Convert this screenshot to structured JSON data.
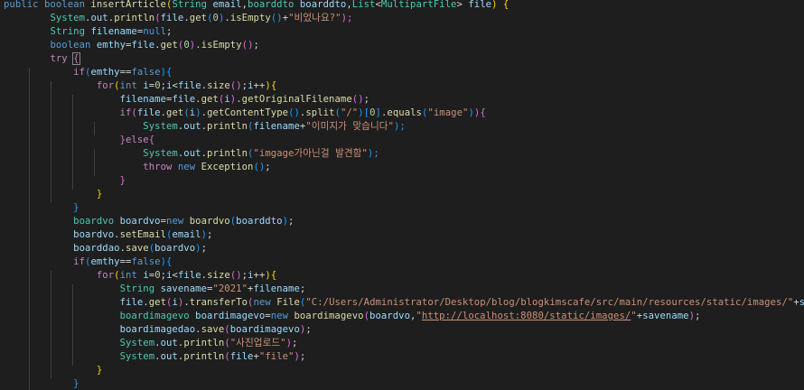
{
  "lines": [
    [
      [
        "public boolean ",
        "kw"
      ],
      [
        "insertArticle",
        "fn"
      ],
      [
        "(",
        "p0"
      ],
      [
        "String ",
        "ty"
      ],
      [
        "email",
        "var"
      ],
      [
        ",",
        "pl"
      ],
      [
        "boarddto ",
        "ty"
      ],
      [
        "boarddto",
        "var"
      ],
      [
        ",",
        "pl"
      ],
      [
        "List",
        "ty"
      ],
      [
        "<",
        "pl"
      ],
      [
        "MultipartFile",
        "ty"
      ],
      [
        "> ",
        "pl"
      ],
      [
        "file",
        "var"
      ],
      [
        ") {",
        "p0"
      ]
    ],
    [
      [
        "        ",
        "pl"
      ],
      [
        "System",
        "ty"
      ],
      [
        ".",
        "pl"
      ],
      [
        "out",
        "var"
      ],
      [
        ".",
        "pl"
      ],
      [
        "println",
        "fn"
      ],
      [
        "(",
        "p1"
      ],
      [
        "file",
        "var"
      ],
      [
        ".",
        "pl"
      ],
      [
        "get",
        "fn"
      ],
      [
        "(",
        "p2"
      ],
      [
        "0",
        "num"
      ],
      [
        ")",
        "p2"
      ],
      [
        ".",
        "pl"
      ],
      [
        "isEmpty",
        "fn"
      ],
      [
        "()",
        "p2"
      ],
      [
        "+",
        "pl"
      ],
      [
        "\"비었나요?\"",
        "str"
      ],
      [
        ");",
        "p1"
      ]
    ],
    [
      [
        "        ",
        "pl"
      ],
      [
        "String ",
        "ty"
      ],
      [
        "filename",
        "var"
      ],
      [
        "=",
        "pl"
      ],
      [
        "null",
        "kw"
      ],
      [
        ";",
        "pl"
      ]
    ],
    [
      [
        "        ",
        "pl"
      ],
      [
        "boolean ",
        "kw"
      ],
      [
        "emthy",
        "var"
      ],
      [
        "=",
        "pl"
      ],
      [
        "file",
        "var"
      ],
      [
        ".",
        "pl"
      ],
      [
        "get",
        "fn"
      ],
      [
        "(",
        "p1"
      ],
      [
        "0",
        "num"
      ],
      [
        ")",
        "p1"
      ],
      [
        ".",
        "pl"
      ],
      [
        "isEmpty",
        "fn"
      ],
      [
        "()",
        "p1"
      ],
      [
        ";",
        "pl"
      ]
    ],
    [
      [
        "        ",
        "pl"
      ],
      [
        "try ",
        "ctl"
      ],
      [
        "{",
        "p1"
      ]
    ],
    [
      [
        "            ",
        "pl"
      ],
      [
        "if",
        "ctl"
      ],
      [
        "(",
        "p2"
      ],
      [
        "emthy",
        "var"
      ],
      [
        "==",
        "pl"
      ],
      [
        "false",
        "kw"
      ],
      [
        ")",
        "p2"
      ],
      [
        "{",
        "p2"
      ]
    ],
    [
      [
        "                ",
        "pl"
      ],
      [
        "for",
        "ctl"
      ],
      [
        "(",
        "p0"
      ],
      [
        "int ",
        "kw"
      ],
      [
        "i",
        "var"
      ],
      [
        "=",
        "pl"
      ],
      [
        "0",
        "num"
      ],
      [
        ";",
        "pl"
      ],
      [
        "i",
        "var"
      ],
      [
        "<",
        "pl"
      ],
      [
        "file",
        "var"
      ],
      [
        ".",
        "pl"
      ],
      [
        "size",
        "fn"
      ],
      [
        "()",
        "p1"
      ],
      [
        ";",
        "pl"
      ],
      [
        "i",
        "var"
      ],
      [
        "++",
        "pl"
      ],
      [
        ")",
        "p0"
      ],
      [
        "{",
        "p0"
      ]
    ],
    [
      [
        "                    ",
        "pl"
      ],
      [
        "filename",
        "var"
      ],
      [
        "=",
        "pl"
      ],
      [
        "file",
        "var"
      ],
      [
        ".",
        "pl"
      ],
      [
        "get",
        "fn"
      ],
      [
        "(",
        "p1"
      ],
      [
        "i",
        "var"
      ],
      [
        ")",
        "p1"
      ],
      [
        ".",
        "pl"
      ],
      [
        "getOriginalFilename",
        "fn"
      ],
      [
        "()",
        "p1"
      ],
      [
        ";",
        "pl"
      ]
    ],
    [
      [
        "                    ",
        "pl"
      ],
      [
        "if",
        "ctl"
      ],
      [
        "(",
        "p1"
      ],
      [
        "file",
        "var"
      ],
      [
        ".",
        "pl"
      ],
      [
        "get",
        "fn"
      ],
      [
        "(",
        "p2"
      ],
      [
        "i",
        "var"
      ],
      [
        ")",
        "p2"
      ],
      [
        ".",
        "pl"
      ],
      [
        "getContentType",
        "fn"
      ],
      [
        "()",
        "p2"
      ],
      [
        ".",
        "pl"
      ],
      [
        "split",
        "fn"
      ],
      [
        "(",
        "p2"
      ],
      [
        "\"/\"",
        "str"
      ],
      [
        ")",
        "p2"
      ],
      [
        "[",
        "p2"
      ],
      [
        "0",
        "num"
      ],
      [
        "]",
        "p2"
      ],
      [
        ".",
        "pl"
      ],
      [
        "equals",
        "fn"
      ],
      [
        "(",
        "p2"
      ],
      [
        "\"image\"",
        "str"
      ],
      [
        ")",
        "p2"
      ],
      [
        ")",
        "p1"
      ],
      [
        "{",
        "p1"
      ]
    ],
    [
      [
        "                        ",
        "pl"
      ],
      [
        "System",
        "ty"
      ],
      [
        ".",
        "pl"
      ],
      [
        "out",
        "var"
      ],
      [
        ".",
        "pl"
      ],
      [
        "println",
        "fn"
      ],
      [
        "(",
        "p2"
      ],
      [
        "filename",
        "var"
      ],
      [
        "+",
        "pl"
      ],
      [
        "\"이미지가 맞습니다\"",
        "str"
      ],
      [
        ");",
        "p2"
      ]
    ],
    [
      [
        "                    ",
        "pl"
      ],
      [
        "}",
        "p1"
      ],
      [
        "else",
        "ctl"
      ],
      [
        "{",
        "p1"
      ]
    ],
    [
      [
        "                        ",
        "pl"
      ],
      [
        "System",
        "ty"
      ],
      [
        ".",
        "pl"
      ],
      [
        "out",
        "var"
      ],
      [
        ".",
        "pl"
      ],
      [
        "println",
        "fn"
      ],
      [
        "(",
        "p2"
      ],
      [
        "\"imgage가아닌걸 발견함\"",
        "str"
      ],
      [
        ");",
        "p2"
      ]
    ],
    [
      [
        "                        ",
        "pl"
      ],
      [
        "throw ",
        "ctl"
      ],
      [
        "new ",
        "kw"
      ],
      [
        "Exception",
        "fn"
      ],
      [
        "()",
        "p2"
      ],
      [
        ";",
        "pl"
      ]
    ],
    [
      [
        "                    ",
        "pl"
      ],
      [
        "}",
        "p1"
      ]
    ],
    [
      [
        "                ",
        "pl"
      ],
      [
        "}",
        "p0"
      ]
    ],
    [
      [
        "            ",
        "pl"
      ],
      [
        "}",
        "p2"
      ]
    ],
    [
      [
        "            ",
        "pl"
      ],
      [
        "boardvo ",
        "ty"
      ],
      [
        "boardvo",
        "var"
      ],
      [
        "=",
        "pl"
      ],
      [
        "new ",
        "kw"
      ],
      [
        "boardvo",
        "fn"
      ],
      [
        "(",
        "p2"
      ],
      [
        "boarddto",
        "var"
      ],
      [
        ")",
        "p2"
      ],
      [
        ";",
        "pl"
      ]
    ],
    [
      [
        "            ",
        "pl"
      ],
      [
        "boardvo",
        "var"
      ],
      [
        ".",
        "pl"
      ],
      [
        "setEmail",
        "fn"
      ],
      [
        "(",
        "p2"
      ],
      [
        "email",
        "var"
      ],
      [
        ")",
        "p2"
      ],
      [
        ";",
        "pl"
      ]
    ],
    [
      [
        "            ",
        "pl"
      ],
      [
        "boarddao",
        "var"
      ],
      [
        ".",
        "pl"
      ],
      [
        "save",
        "fn"
      ],
      [
        "(",
        "p2"
      ],
      [
        "boardvo",
        "var"
      ],
      [
        ")",
        "p2"
      ],
      [
        ";",
        "pl"
      ]
    ],
    [
      [
        "            ",
        "pl"
      ],
      [
        "if",
        "ctl"
      ],
      [
        "(",
        "p2"
      ],
      [
        "emthy",
        "var"
      ],
      [
        "==",
        "pl"
      ],
      [
        "false",
        "kw"
      ],
      [
        ")",
        "p2"
      ],
      [
        "{",
        "p2"
      ]
    ],
    [
      [
        "                ",
        "pl"
      ],
      [
        "for",
        "ctl"
      ],
      [
        "(",
        "p0"
      ],
      [
        "int ",
        "kw"
      ],
      [
        "i",
        "var"
      ],
      [
        "=",
        "pl"
      ],
      [
        "0",
        "num"
      ],
      [
        ";",
        "pl"
      ],
      [
        "i",
        "var"
      ],
      [
        "<",
        "pl"
      ],
      [
        "file",
        "var"
      ],
      [
        ".",
        "pl"
      ],
      [
        "size",
        "fn"
      ],
      [
        "()",
        "p1"
      ],
      [
        ";",
        "pl"
      ],
      [
        "i",
        "var"
      ],
      [
        "++",
        "pl"
      ],
      [
        ")",
        "p0"
      ],
      [
        "{",
        "p0"
      ]
    ],
    [
      [
        "                    ",
        "pl"
      ],
      [
        "String ",
        "ty"
      ],
      [
        "savename",
        "var"
      ],
      [
        "=",
        "pl"
      ],
      [
        "\"2021\"",
        "str"
      ],
      [
        "+",
        "pl"
      ],
      [
        "filename",
        "var"
      ],
      [
        ";",
        "pl"
      ]
    ],
    [
      [
        "                    ",
        "pl"
      ],
      [
        "file",
        "var"
      ],
      [
        ".",
        "pl"
      ],
      [
        "get",
        "fn"
      ],
      [
        "(",
        "p1"
      ],
      [
        "i",
        "var"
      ],
      [
        ")",
        "p1"
      ],
      [
        ".",
        "pl"
      ],
      [
        "transferTo",
        "fn"
      ],
      [
        "(",
        "p1"
      ],
      [
        "new ",
        "kw"
      ],
      [
        "File",
        "fn"
      ],
      [
        "(",
        "p2"
      ],
      [
        "\"C:/Users/Administrator/Desktop/blog/blogkimscafe/src/main/resources/static/images/\"",
        "str"
      ],
      [
        "+",
        "pl"
      ],
      [
        "savename",
        "var"
      ],
      [
        ")",
        "p2"
      ],
      [
        ");",
        "p1"
      ]
    ],
    [
      [
        "                    ",
        "pl"
      ],
      [
        "boardimagevo ",
        "ty"
      ],
      [
        "boardimagevo",
        "var"
      ],
      [
        "=",
        "pl"
      ],
      [
        "new ",
        "kw"
      ],
      [
        "boardimagevo",
        "fn"
      ],
      [
        "(",
        "p1"
      ],
      [
        "boardvo",
        "var"
      ],
      [
        ",",
        "pl"
      ],
      [
        "\"",
        "str"
      ],
      [
        "http://localhost:8080/static/images/",
        "str u"
      ],
      [
        "\"",
        "str"
      ],
      [
        "+",
        "pl"
      ],
      [
        "savename",
        "var"
      ],
      [
        ")",
        "p1"
      ],
      [
        ";",
        "pl"
      ]
    ],
    [
      [
        "                    ",
        "pl"
      ],
      [
        "boardimagedao",
        "var"
      ],
      [
        ".",
        "pl"
      ],
      [
        "save",
        "fn"
      ],
      [
        "(",
        "p1"
      ],
      [
        "boardimagevo",
        "var"
      ],
      [
        ")",
        "p1"
      ],
      [
        ";",
        "pl"
      ]
    ],
    [
      [
        "                    ",
        "pl"
      ],
      [
        "System",
        "ty"
      ],
      [
        ".",
        "pl"
      ],
      [
        "out",
        "var"
      ],
      [
        ".",
        "pl"
      ],
      [
        "println",
        "fn"
      ],
      [
        "(",
        "p1"
      ],
      [
        "\"사진업로드\"",
        "str"
      ],
      [
        ")",
        "p1"
      ],
      [
        ";",
        "pl"
      ]
    ],
    [
      [
        "                    ",
        "pl"
      ],
      [
        "System",
        "ty"
      ],
      [
        ".",
        "pl"
      ],
      [
        "out",
        "var"
      ],
      [
        ".",
        "pl"
      ],
      [
        "println",
        "fn"
      ],
      [
        "(",
        "p1"
      ],
      [
        "file",
        "var"
      ],
      [
        "+",
        "pl"
      ],
      [
        "\"file\"",
        "str"
      ],
      [
        ")",
        "p1"
      ],
      [
        ";",
        "pl"
      ]
    ],
    [
      [
        "                ",
        "pl"
      ],
      [
        "}",
        "p0"
      ]
    ],
    [
      [
        "            ",
        "pl"
      ],
      [
        "}",
        "p2"
      ]
    ]
  ]
}
